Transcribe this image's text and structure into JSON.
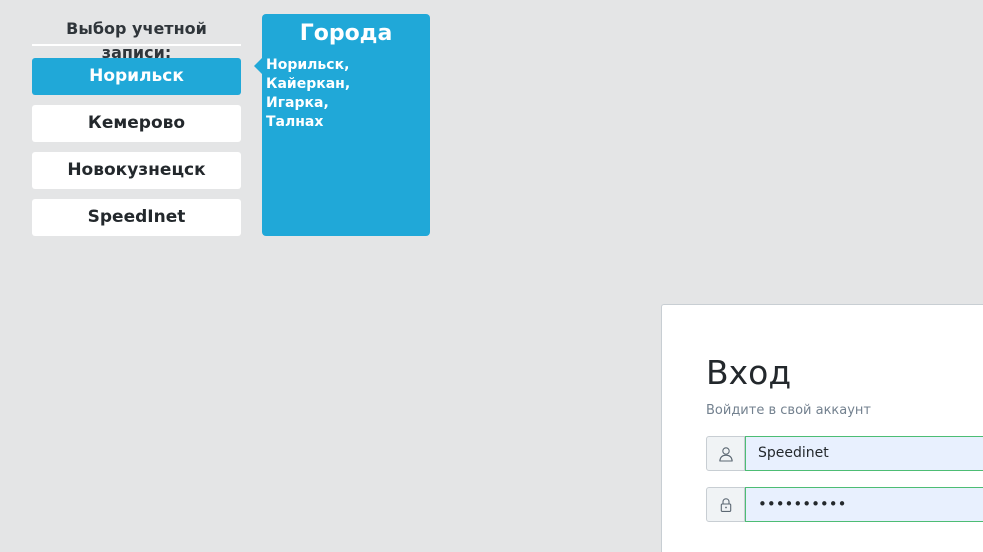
{
  "account_selector": {
    "title": "Выбор учетной записи:",
    "accounts": [
      {
        "label": "Норильск",
        "active": true
      },
      {
        "label": "Кемерово",
        "active": false
      },
      {
        "label": "Новокузнецск",
        "active": false
      },
      {
        "label": "SpeedInet",
        "active": false
      }
    ]
  },
  "cities_panel": {
    "title": "Города",
    "cities": [
      "Норильск,",
      "Кайеркан,",
      "Игарка,",
      "Талнах"
    ]
  },
  "login": {
    "title": "Вход",
    "subtitle": "Войдите в свой аккаунт",
    "username_value": "Speedinet",
    "password_value": "••••••••••",
    "username_icon": "user-icon",
    "password_icon": "lock-icon"
  },
  "colors": {
    "background": "#e4e5e6",
    "accent": "#20a8d8",
    "input_valid_border": "#4dbd74",
    "input_autofill_bg": "#e8f0fe"
  }
}
